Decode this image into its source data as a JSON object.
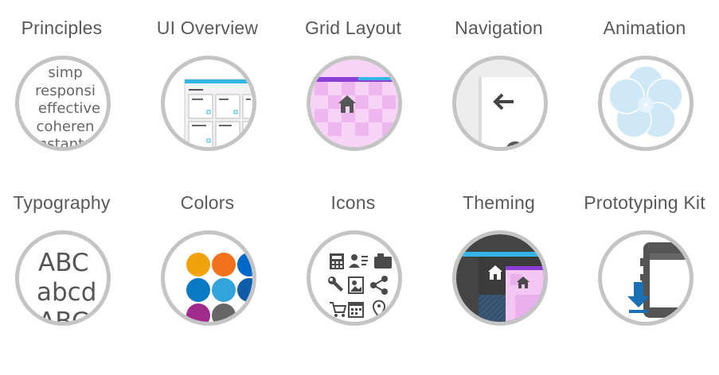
{
  "topics": [
    {
      "label": "Principles",
      "icon": "principles-words-icon",
      "words": [
        "simp",
        "responsi",
        "effective",
        "coheren",
        "instant"
      ]
    },
    {
      "label": "UI Overview",
      "icon": "ui-overview-screens-icon"
    },
    {
      "label": "Grid Layout",
      "icon": "grid-layout-icon"
    },
    {
      "label": "Navigation",
      "icon": "back-arrow-icon"
    },
    {
      "label": "Animation",
      "icon": "animation-flower-icon"
    },
    {
      "label": "Typography",
      "icon": "typography-sample-icon",
      "samples": [
        "ABC",
        "abcd",
        "ABC"
      ]
    },
    {
      "label": "Colors",
      "icon": "color-swatches-icon",
      "swatches": [
        "#f0a30a",
        "#f2711c",
        "#0068c9",
        "#0a7ac5",
        "#33a3dc",
        "#0f5da8",
        "#a12b8d",
        "#666666"
      ]
    },
    {
      "label": "Icons",
      "icon": "icon-set-icon"
    },
    {
      "label": "Theming",
      "icon": "theming-icon"
    },
    {
      "label": "Prototyping Kit",
      "icon": "download-kit-icon"
    }
  ],
  "colors": {
    "label": "#595959",
    "ring": "#c4c4c4",
    "accent_blue": "#33b5e5",
    "grid_pink": "#f4c2f4",
    "grid_purple": "#8b3fd6"
  }
}
